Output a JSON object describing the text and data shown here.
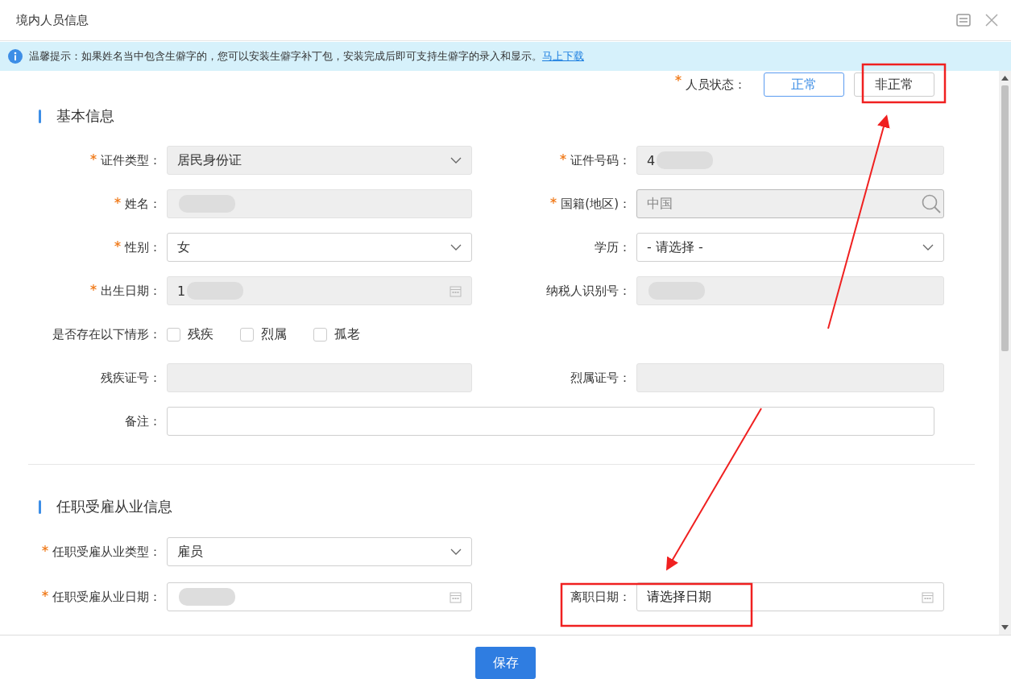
{
  "window": {
    "title": "境内人员信息"
  },
  "notice": {
    "text": "温馨提示：如果姓名当中包含生僻字的，您可以安装生僻字补丁包，安装完成后即可支持生僻字的录入和显示。",
    "link": "马上下载"
  },
  "person_status": {
    "label": "人员状态：",
    "required": true,
    "options": [
      {
        "label": "正常",
        "selected": true
      },
      {
        "label": "非正常",
        "selected": false
      }
    ]
  },
  "sections": [
    {
      "title": "基本信息",
      "rows": [
        [
          {
            "label": "证件类型：",
            "required": true,
            "kind": "select",
            "value": "居民身份证",
            "disabled": true
          },
          {
            "label": "证件号码：",
            "required": true,
            "kind": "text",
            "value": "4",
            "redacted": true,
            "disabled": true
          }
        ],
        [
          {
            "label": "姓名：",
            "required": true,
            "kind": "text",
            "redacted": true,
            "disabled": true
          },
          {
            "label": "国籍(地区)：",
            "required": true,
            "kind": "search",
            "value": "中国",
            "disabled": true
          }
        ],
        [
          {
            "label": "性别：",
            "required": true,
            "kind": "select",
            "value": "女",
            "disabled": false
          },
          {
            "label": "学历：",
            "kind": "select",
            "value": "- 请选择 -",
            "disabled": false
          }
        ],
        [
          {
            "label": "出生日期：",
            "required": true,
            "kind": "date",
            "value": "1",
            "redacted": true,
            "disabled": true
          },
          {
            "label": "纳税人识别号：",
            "kind": "text",
            "redacted": true,
            "disabled": true
          }
        ],
        [
          {
            "label": "是否存在以下情形：",
            "kind": "checks",
            "options": [
              {
                "label": "残疾",
                "checked": false
              },
              {
                "label": "烈属",
                "checked": false
              },
              {
                "label": "孤老",
                "checked": false
              }
            ]
          }
        ],
        [
          {
            "label": "残疾证号：",
            "kind": "text",
            "disabled": true
          },
          {
            "label": "烈属证号：",
            "kind": "text",
            "disabled": true
          }
        ],
        [
          {
            "label": "备注：",
            "kind": "remark",
            "disabled": false
          }
        ]
      ]
    },
    {
      "title": "任职受雇从业信息",
      "rows": [
        [
          {
            "label": "任职受雇从业类型：",
            "required": true,
            "kind": "select",
            "value": "雇员",
            "disabled": false
          }
        ],
        [
          {
            "label": "任职受雇从业日期：",
            "required": true,
            "kind": "date",
            "redacted": true,
            "disabled": false
          },
          {
            "label": "离职日期：",
            "kind": "date",
            "placeholder": "请选择日期",
            "disabled": false
          }
        ]
      ]
    }
  ],
  "footer": {
    "save": "保存"
  }
}
